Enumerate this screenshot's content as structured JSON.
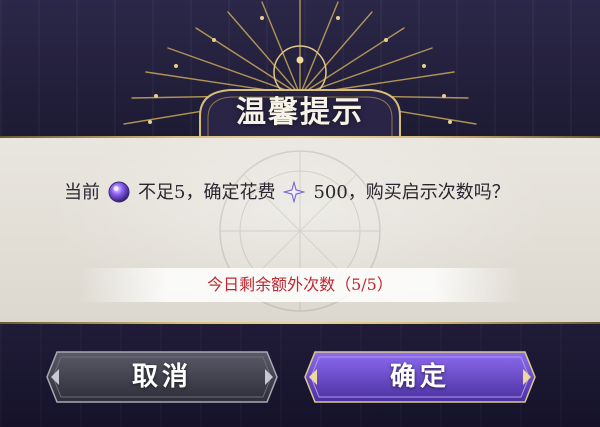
{
  "dialog": {
    "title": "温馨提示",
    "message_part1": "当前",
    "message_part2": "不足5，确定花费",
    "message_part3": "500，购买启示次数吗？",
    "remaining_label": "今日剩余额外次数（5/5）",
    "cancel_label": "取消",
    "confirm_label": "确定"
  },
  "icons": {
    "currency_a": "purple-orb-icon",
    "currency_b": "star-crystal-icon",
    "emblem": "crescent-moon-icon"
  },
  "colors": {
    "gold": "#d6bd7a",
    "confirm_button": "#6a4bc4",
    "cancel_button": "#3e3e4c",
    "remaining_text": "#c2262e"
  }
}
